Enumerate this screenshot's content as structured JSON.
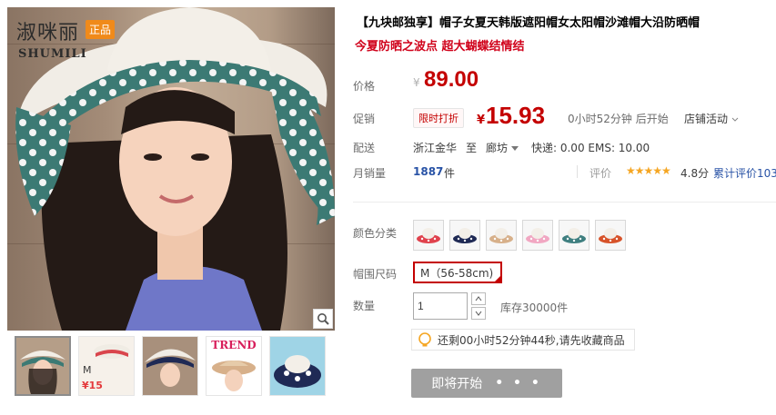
{
  "brand": {
    "name_cn": "淑咪丽",
    "tag": "正品",
    "name_en": "SHUMILI"
  },
  "gallery": {
    "thumbs": [
      {
        "label": "",
        "price": ""
      },
      {
        "label": "",
        "price": "¥15"
      },
      {
        "label": "",
        "price": ""
      },
      {
        "label": "TREND",
        "price": ""
      },
      {
        "label": "",
        "price": ""
      }
    ]
  },
  "product": {
    "title": "【九块邮独享】帽子女夏天韩版遮阳帽女太阳帽沙滩帽大沿防晒帽",
    "subtitle": "今夏防晒之波点 超大蝴蝶结情结"
  },
  "price": {
    "label": "价格",
    "currency": "¥",
    "value": "89.00"
  },
  "promo": {
    "label": "促销",
    "tag": "限时打折",
    "currency": "¥",
    "value": "15.93",
    "countdown": "0小时52分钟 后开始",
    "store_activity": "店铺活动"
  },
  "shipping": {
    "label": "配送",
    "from": "浙江金华",
    "to_word": "至",
    "to_city": "廊坊",
    "fee": "快递: 0.00 EMS: 10.00"
  },
  "sales": {
    "label": "月销量",
    "count": "1887",
    "unit": "件",
    "rating_label": "评价",
    "stars": "★★★★★",
    "rating": "4.8分",
    "review_link": "累计评价103"
  },
  "options": {
    "color_label": "颜色分类",
    "size_label": "帽围尺码",
    "size_value": "M（56-58cm)",
    "qty_label": "数量",
    "qty_value": "1",
    "stock": "库存30000件"
  },
  "colors": {
    "swatches": [
      "#e0424d",
      "#1f2a55",
      "#d7b08a",
      "#f1a7c2",
      "#3f7f80",
      "#d7532a"
    ],
    "accent_red": "#c40000",
    "link_blue": "#2953a6"
  },
  "notice": {
    "text": "还剩00小时52分钟44秒,请先收藏商品"
  },
  "buy": {
    "label": "即将开始",
    "dots": "• • •"
  }
}
